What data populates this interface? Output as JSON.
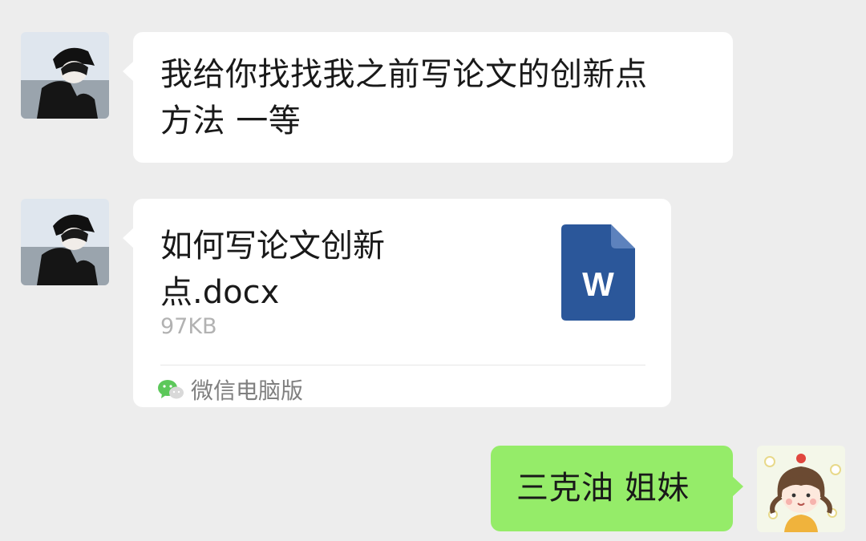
{
  "messages": [
    {
      "sender": "other",
      "type": "text",
      "text": "我给你找找我之前写论文的创新点\n方法 一等"
    },
    {
      "sender": "other",
      "type": "file",
      "file_name": "如何写论文创新\n点.docx",
      "file_size": "97KB",
      "source": "微信电脑版",
      "file_icon_letter": "W",
      "file_icon": "word-doc-icon"
    },
    {
      "sender": "self",
      "type": "text",
      "text": "三克油 姐妹"
    }
  ],
  "colors": {
    "background": "#ededed",
    "incoming_bubble": "#ffffff",
    "outgoing_bubble": "#95ec69",
    "word_icon": "#2b579a",
    "muted_text": "#b2b2b2"
  }
}
